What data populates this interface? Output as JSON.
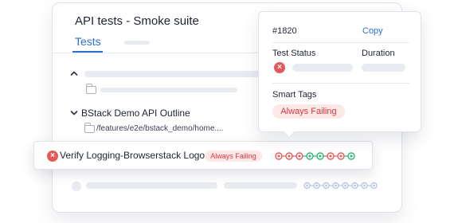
{
  "panel": {
    "title": "API tests - Smoke suite",
    "tabs": [
      {
        "label": "Tests",
        "active": true
      }
    ]
  },
  "test_group": {
    "name": "BStack Demo API Outline",
    "path": "/features/e2e/bstack_demo/home...."
  },
  "test_row": {
    "name": "Verify Logging-Browserstack Logo",
    "status_icon": "x-circle-icon",
    "tag": "Always Failing",
    "run_history": [
      "fail",
      "fail",
      "fail",
      "pass",
      "pass",
      "fail",
      "fail",
      "pass"
    ]
  },
  "faded_row": {
    "run_history": [
      "muted",
      "muted",
      "muted",
      "muted",
      "muted",
      "muted",
      "muted",
      "muted"
    ]
  },
  "popover": {
    "id": "#1820",
    "copy_label": "Copy",
    "test_status_label": "Test Status",
    "duration_label": "Duration",
    "status_icon": "x-circle-icon",
    "smart_tags_label": "Smart Tags",
    "smart_tag": "Always Failing"
  },
  "colors": {
    "accent": "#2d6ed3",
    "fail": "#e45a5a",
    "pass": "#2fb47a",
    "muted": "#b9c7e6",
    "badge_bg": "#fde8e8",
    "badge_text": "#d9363e"
  }
}
